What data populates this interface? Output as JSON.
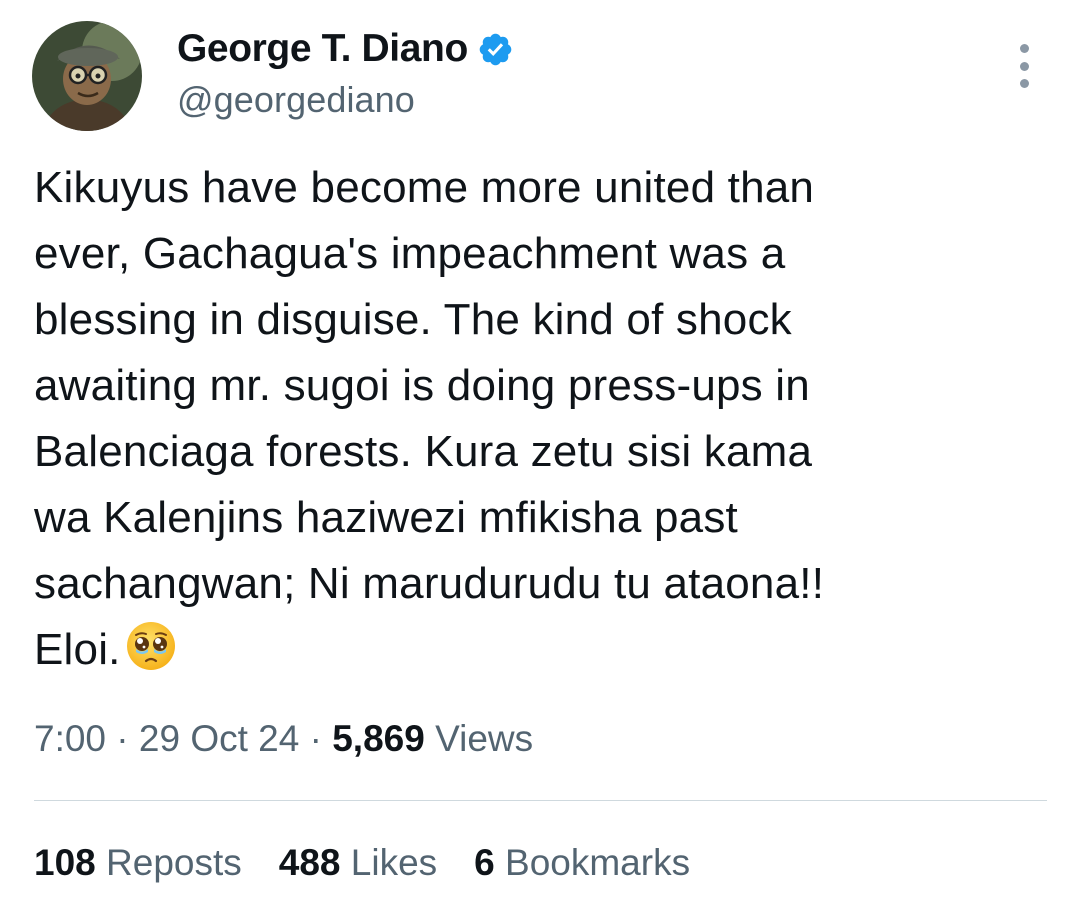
{
  "author": {
    "display_name": "George T. Diano",
    "handle": "@georgediano",
    "verified": true,
    "verified_color": "#1d9bf0"
  },
  "tweet": {
    "text": "Kikuyus have become more united than\never, Gachagua's impeachment was a\nblessing in disguise. The kind of shock\nawaiting mr. sugoi is doing press-ups in\nBalenciaga forests. Kura zetu sisi kama\nwa Kalenjins haziwezi mfikisha past\nsachangwan; Ni marudurudu tu ataona!!\nEloi.",
    "emoji": "pleading-face-with-tears"
  },
  "meta": {
    "time": "7:00",
    "separator": "·",
    "date": "29 Oct 24",
    "views_count": "5,869",
    "views_label": "Views"
  },
  "stats": {
    "reposts_count": "108",
    "reposts_label": "Reposts",
    "likes_count": "488",
    "likes_label": "Likes",
    "bookmarks_count": "6",
    "bookmarks_label": "Bookmarks"
  },
  "icons": {
    "more": "more-options-icon",
    "verified": "verified-badge-icon"
  }
}
